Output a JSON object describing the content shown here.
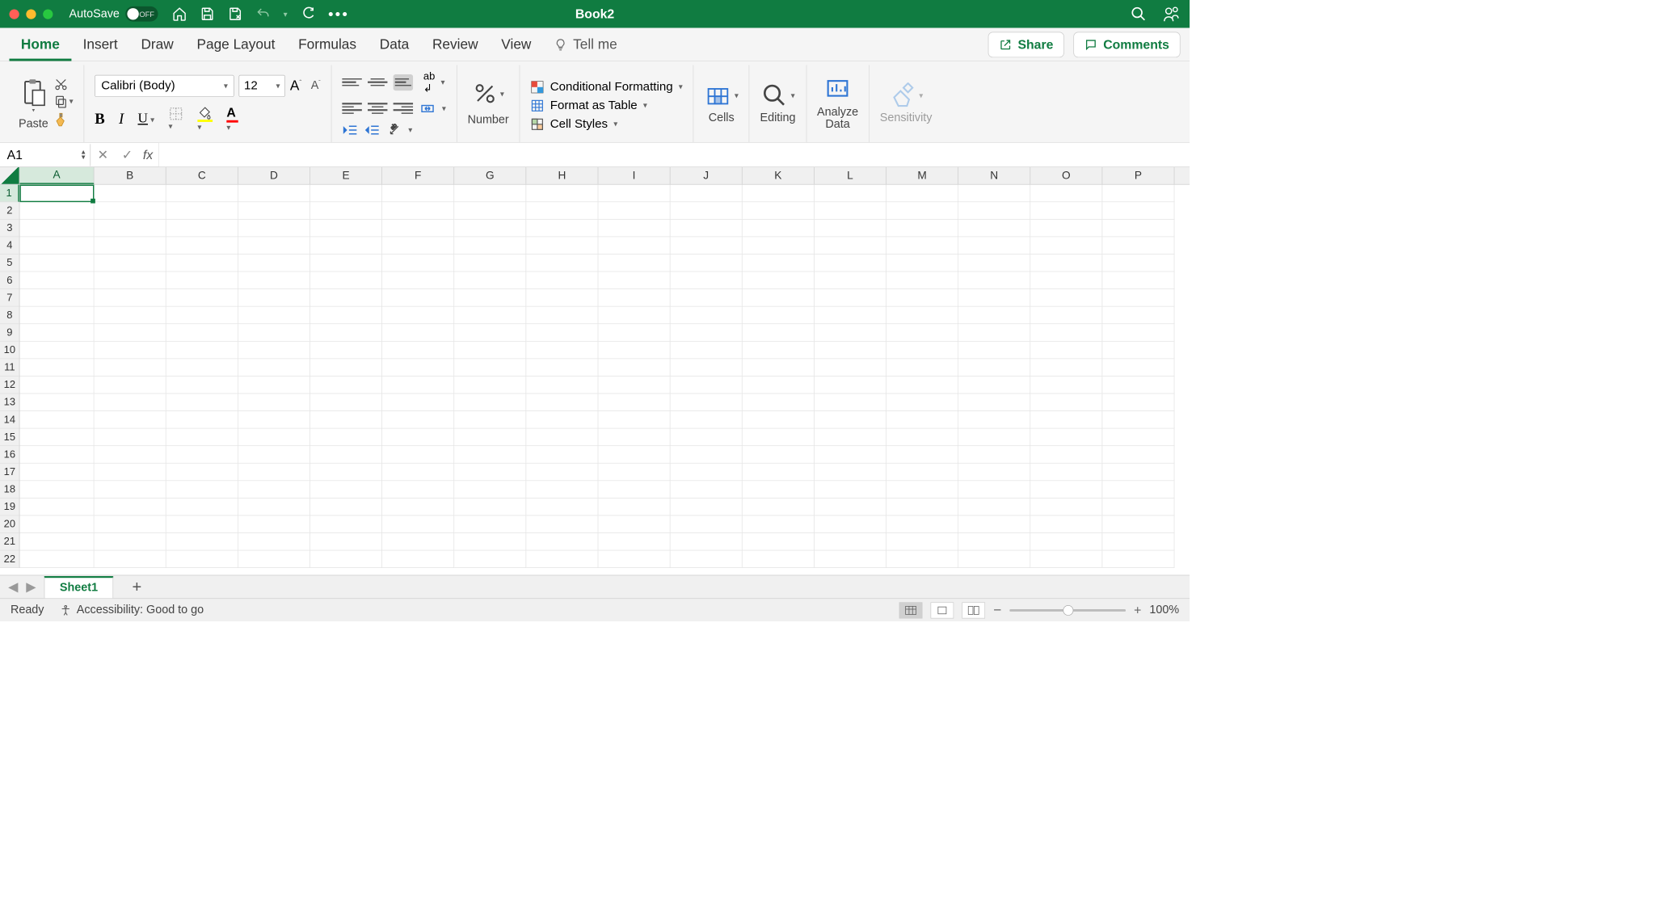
{
  "titlebar": {
    "autosave_label": "AutoSave",
    "autosave_state": "OFF",
    "title": "Book2"
  },
  "tabs": {
    "items": [
      "Home",
      "Insert",
      "Draw",
      "Page Layout",
      "Formulas",
      "Data",
      "Review",
      "View"
    ],
    "active": "Home",
    "tellme": "Tell me",
    "share": "Share",
    "comments": "Comments"
  },
  "ribbon": {
    "paste": "Paste",
    "font_name": "Calibri (Body)",
    "font_size": "12",
    "number": "Number",
    "cond_fmt": "Conditional Formatting",
    "fmt_table": "Format as Table",
    "cell_styles": "Cell Styles",
    "cells": "Cells",
    "editing": "Editing",
    "analyze1": "Analyze",
    "analyze2": "Data",
    "sensitivity": "Sensitivity"
  },
  "formula": {
    "namebox": "A1",
    "value": ""
  },
  "grid": {
    "cols": [
      "A",
      "B",
      "C",
      "D",
      "E",
      "F",
      "G",
      "H",
      "I",
      "J",
      "K",
      "L",
      "M",
      "N",
      "O",
      "P"
    ],
    "rows": 22,
    "selected_col": "A",
    "selected_row": 1
  },
  "sheets": {
    "active": "Sheet1"
  },
  "status": {
    "ready": "Ready",
    "accessibility": "Accessibility: Good to go",
    "zoom": "100%"
  }
}
